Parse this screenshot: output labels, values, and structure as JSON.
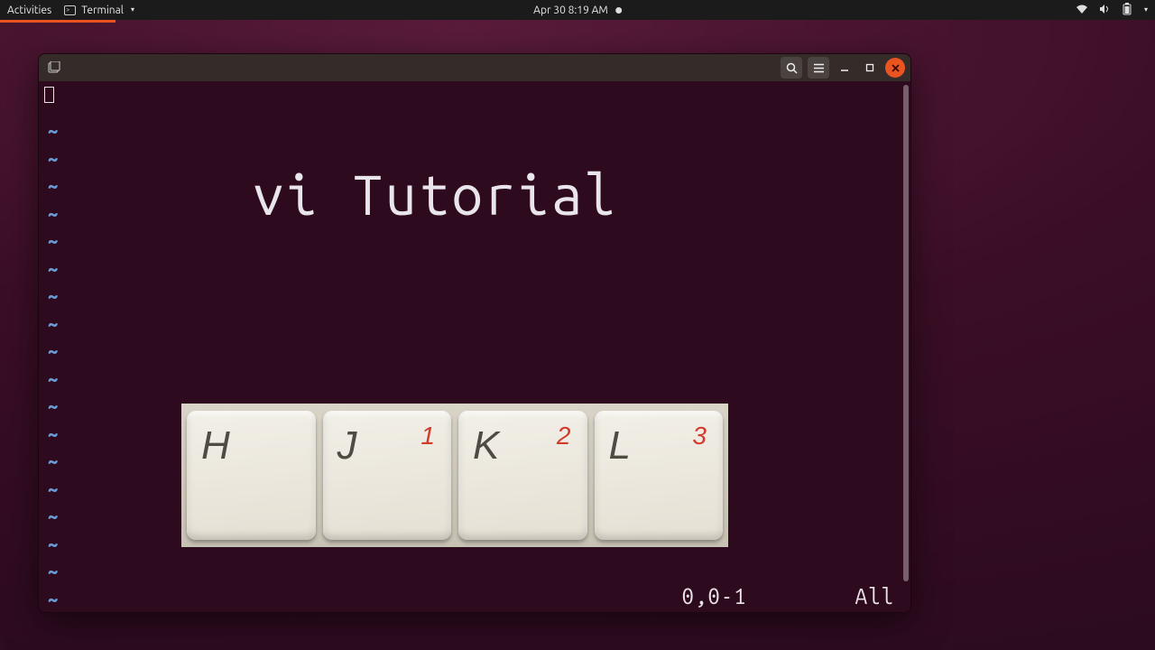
{
  "topbar": {
    "activities": "Activities",
    "app_name": "Terminal",
    "datetime": "Apr 30  8:19 AM"
  },
  "window": {
    "tilde": "~",
    "tilde_count": 18,
    "status": {
      "position": "0,0-1",
      "view": "All"
    }
  },
  "overlay": {
    "title": "vi Tutorial",
    "keys": [
      {
        "main": "H",
        "sub": ""
      },
      {
        "main": "J",
        "sub": "1"
      },
      {
        "main": "K",
        "sub": "2"
      },
      {
        "main": "L",
        "sub": "3"
      }
    ]
  }
}
